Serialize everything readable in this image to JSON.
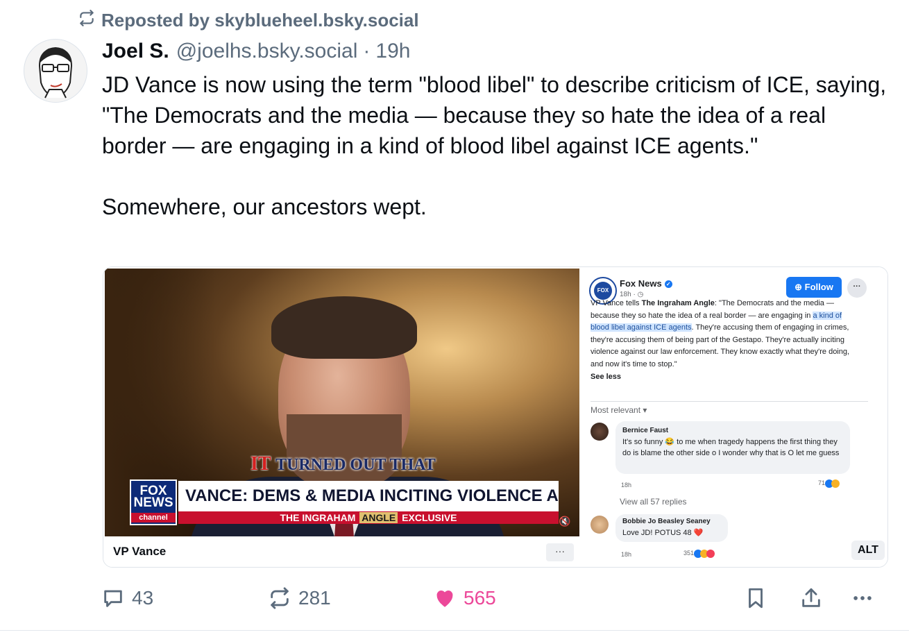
{
  "repost": {
    "text": "Reposted by skyblueheel.bsky.social"
  },
  "post": {
    "author_name": "Joel S.",
    "handle": "@joelhs.bsky.social",
    "separator": "·",
    "time": "19h",
    "paragraph1": "JD Vance is now using the term \"blood libel\" to describe criticism of ICE, saying, \"The Democrats and the media — because they so hate the idea of a real border — are engaging in a kind of blood libel against ICE agents.\"",
    "paragraph2": "Somewhere, our ancestors wept."
  },
  "embed": {
    "video": {
      "kicker_red": "IT",
      "kicker_rest": "TURNED OUT THAT",
      "logo_line1": "FOX",
      "logo_line2": "NEWS",
      "logo_channel": "channel",
      "headline": "VANCE: DEMS & MEDIA INCITING VIOLENCE AGAINST ICE",
      "subline_a": "THE INGRAHAM",
      "subline_b": "ANGLE",
      "subline_c": "EXCLUSIVE",
      "label": "VP Vance",
      "more": "···"
    },
    "fb": {
      "page_name": "Fox News",
      "logo_text": "FOX NEWS",
      "time": "18h · ◷",
      "follow": "Follow",
      "more": "···",
      "body_a": "VP Vance tells ",
      "body_b": "The Ingraham Angle",
      "body_c": ": \"The Democrats and the media — because they so hate the idea of a real border — are engaging in ",
      "body_highlight": "a kind of blood libel against ICE agents",
      "body_d": ". They're accusing them of engaging in crimes, they're accusing them of being part of the Gestapo. They're actually inciting violence against our law enforcement. They know exactly what they're doing, and now it's time to stop.\"",
      "see_less": "See less",
      "sort": "Most relevant ▾",
      "comments": [
        {
          "name": "Bernice Faust",
          "text": "It's so funny 😂 to me when tragedy happens the first thing they do is blame the other side o I wonder why that is O let me guess",
          "time": "18h",
          "reactions": "71"
        },
        {
          "name": "Bobbie Jo Beasley Seaney",
          "text": "Love JD! POTUS 48 ❤️",
          "time": "18h",
          "reactions": "351"
        }
      ],
      "view_replies": "View all 57 replies"
    },
    "alt": "ALT"
  },
  "actions": {
    "replies": "43",
    "reposts": "281",
    "likes": "565"
  },
  "colors": {
    "like": "#ec4899",
    "muted": "#5b6b7c",
    "follow": "#1877f2"
  }
}
